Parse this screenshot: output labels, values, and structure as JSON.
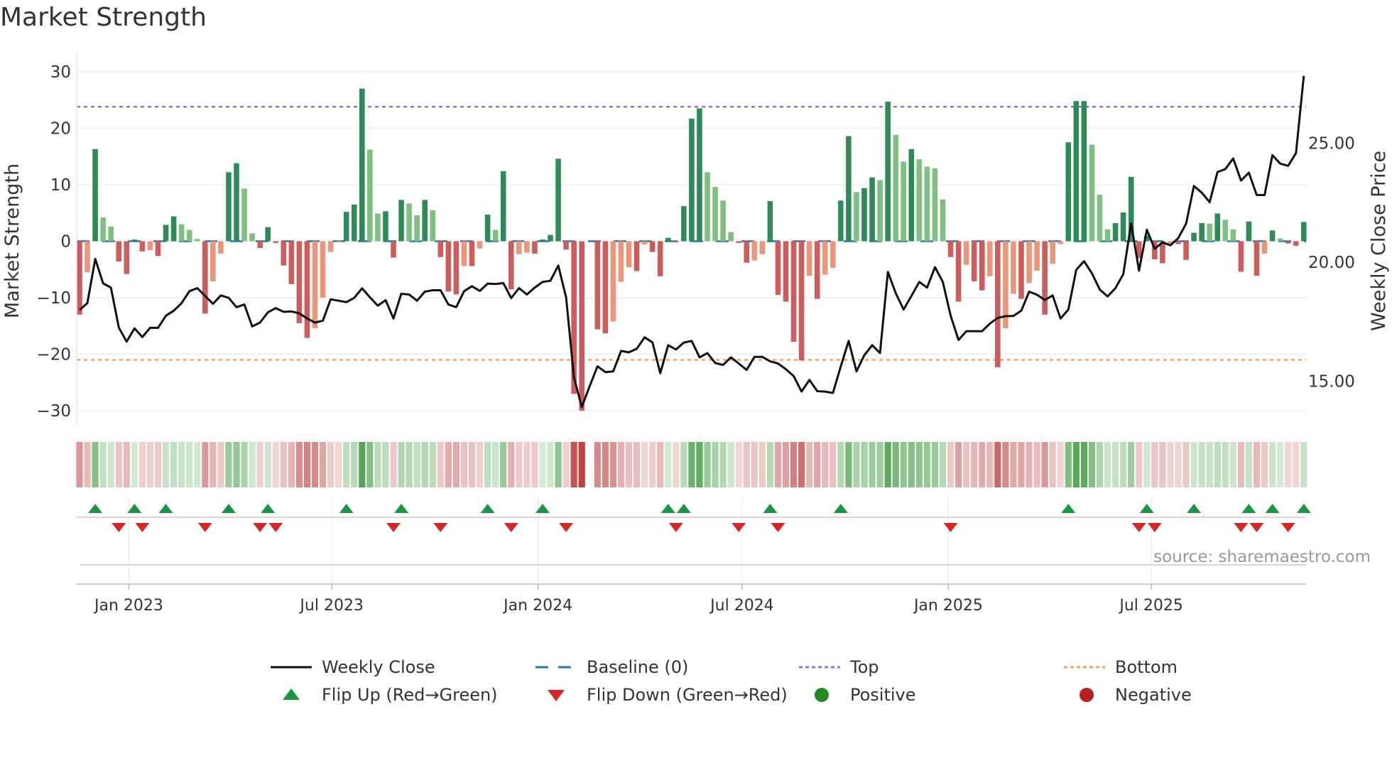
{
  "title": "Market Strength",
  "source": "source: sharemaestro.com",
  "chart_data": {
    "type": "bar",
    "title": "Market Strength",
    "ylabel": "Market Strength",
    "y2label": "Weekly Close Price",
    "ylim": [
      -32.5,
      32.5
    ],
    "y2lim": [
      13.16,
      28.6
    ],
    "yticks": [
      30,
      20,
      10,
      0,
      -10,
      -20,
      -30
    ],
    "ytick_labels": [
      "30",
      "20",
      "10",
      "0",
      "−10",
      "−20",
      "−30"
    ],
    "y2ticks": [
      25,
      20,
      15
    ],
    "y2tick_labels": [
      "25.00",
      "20.00",
      "15.00"
    ],
    "xticks": [
      {
        "date": "2023-01-01",
        "label": "Jan 2023"
      },
      {
        "date": "2023-07-01",
        "label": "Jul 2023"
      },
      {
        "date": "2024-01-01",
        "label": "Jan 2024"
      },
      {
        "date": "2024-07-01",
        "label": "Jul 2024"
      },
      {
        "date": "2025-01-01",
        "label": "Jan 2025"
      },
      {
        "date": "2025-07-01",
        "label": "Jul 2025"
      }
    ],
    "start_date": "2022-11-18",
    "interval_days": 7,
    "top_level": 23.8,
    "bottom_level": -21,
    "baseline": 0,
    "strength": [
      -13,
      -5.5,
      16.3,
      4.2,
      2.6,
      -3.6,
      -5.8,
      0.3,
      -1.8,
      -1.6,
      -2.6,
      2.9,
      4.4,
      3.0,
      2.0,
      0.4,
      -12.8,
      -7.1,
      -2.2,
      12.2,
      13.8,
      9.3,
      1.4,
      -1.2,
      2.5,
      -0.3,
      -4.3,
      -7.6,
      -14.5,
      -17.1,
      -15.4,
      -10.0,
      -1.9,
      -0.2,
      5.2,
      6.5,
      27,
      16.2,
      4.9,
      5.3,
      -2.9,
      7.3,
      6.7,
      4.6,
      7.3,
      5.5,
      -2.8,
      -8.9,
      -9.4,
      -4.4,
      -4.4,
      -1.3,
      4.7,
      2.0,
      12.4,
      -8.5,
      -2.3,
      -2.0,
      -2.2,
      0.3,
      1.1,
      14.6,
      -1.5,
      -27,
      -30,
      null,
      -15.6,
      -16.3,
      -14.2,
      -7.2,
      -4.6,
      -5.3,
      -0.6,
      -1.9,
      -6.2,
      0.6,
      -0.2,
      6.2,
      21.7,
      23.5,
      12.2,
      9.6,
      7.2,
      1.6,
      -0.3,
      -3.8,
      -3.4,
      -2.3,
      7.1,
      -9.5,
      -10.7,
      -17.8,
      -21.1,
      -6.1,
      -10.2,
      -5.9,
      -4.7,
      7.2,
      18.6,
      8.7,
      9.4,
      11.3,
      10.8,
      24.7,
      18.8,
      14.1,
      16.3,
      14.5,
      13.2,
      12.9,
      7.4,
      -2.8,
      -10.7,
      -4.2,
      -7.1,
      -8.7,
      -6.2,
      -22.3,
      -15.4,
      -9.3,
      -10.2,
      -7.4,
      -5.2,
      -13,
      -4.0,
      -0.5,
      17.5,
      24.8,
      24.8,
      17.1,
      8.2,
      2.1,
      3.2,
      5.1,
      11.4,
      -3.0,
      1.0,
      -3.2,
      -3.9,
      -0.4,
      -0.5,
      -3.3,
      1.5,
      3.2,
      3.1,
      4.9,
      3.8,
      2.1,
      -5.4,
      3.5,
      -6.1,
      -2.2,
      1.9,
      0.5,
      -0.4,
      -0.8,
      3.4
    ],
    "weekly_close": [
      17.99,
      18.28,
      20.14,
      19.11,
      18.93,
      17.25,
      16.66,
      17.22,
      16.85,
      17.24,
      17.24,
      17.75,
      17.96,
      18.28,
      18.78,
      18.91,
      18.58,
      18.25,
      18.6,
      18.5,
      18.11,
      18.22,
      17.3,
      17.46,
      17.89,
      18.07,
      17.91,
      17.93,
      17.85,
      17.63,
      17.46,
      17.54,
      18.44,
      18.38,
      18.32,
      18.5,
      18.9,
      18.52,
      18.17,
      18.4,
      17.63,
      18.67,
      18.64,
      18.38,
      18.76,
      18.82,
      18.82,
      18.22,
      18.11,
      18.78,
      18.99,
      18.79,
      19.1,
      19.08,
      19.12,
      18.49,
      18.91,
      18.64,
      18.93,
      19.17,
      19.22,
      19.86,
      18.52,
      15.15,
      13.91,
      14.79,
      15.62,
      15.38,
      15.41,
      16.27,
      16.21,
      16.36,
      16.84,
      16.63,
      15.33,
      16.51,
      16.33,
      16.62,
      16.69,
      16.0,
      16.18,
      15.76,
      15.68,
      16.0,
      15.74,
      15.47,
      16.02,
      16.02,
      15.83,
      15.74,
      15.5,
      15.21,
      14.56,
      15.05,
      14.58,
      14.56,
      14.5,
      15.62,
      16.69,
      15.41,
      16.09,
      16.51,
      16.18,
      19.59,
      18.7,
      18.01,
      18.58,
      19.17,
      18.93,
      19.79,
      19.17,
      17.75,
      16.73,
      17.1,
      17.1,
      17.1,
      17.42,
      17.66,
      17.73,
      17.74,
      17.96,
      18.76,
      18.63,
      18.41,
      18.6,
      17.63,
      18.01,
      19.68,
      20.04,
      19.53,
      18.85,
      18.56,
      18.91,
      19.5,
      21.63,
      19.64,
      21.36,
      20.56,
      20.83,
      20.71,
      21.01,
      21.62,
      23.2,
      22.92,
      22.52,
      23.79,
      23.91,
      24.36,
      23.43,
      23.76,
      22.82,
      22.82,
      24.5,
      24.14,
      24.05,
      24.58,
      27.83
    ],
    "legend": [
      {
        "key": "weekly_close",
        "label": "Weekly Close"
      },
      {
        "key": "baseline",
        "label": "Baseline (0)"
      },
      {
        "key": "top",
        "label": "Top"
      },
      {
        "key": "bottom",
        "label": "Bottom"
      },
      {
        "key": "flip_up",
        "label": "Flip Up (Red→Green)"
      },
      {
        "key": "flip_down",
        "label": "Flip Down (Green→Red)"
      },
      {
        "key": "positive",
        "label": "Positive"
      },
      {
        "key": "negative",
        "label": "Negative"
      }
    ],
    "colors": {
      "pos_strong": "#2e8b57",
      "pos_weak": "#7fbf7f",
      "neg_strong": "#cd5c5c",
      "neg_weak": "#e9967a",
      "line": "#111111",
      "baseline": "#1f77b4",
      "top": "#9370db",
      "bottom": "#f4a460",
      "flip_up": "#1a9641",
      "flip_down": "#d62728",
      "positive": "#228b22",
      "negative": "#b22222"
    }
  }
}
